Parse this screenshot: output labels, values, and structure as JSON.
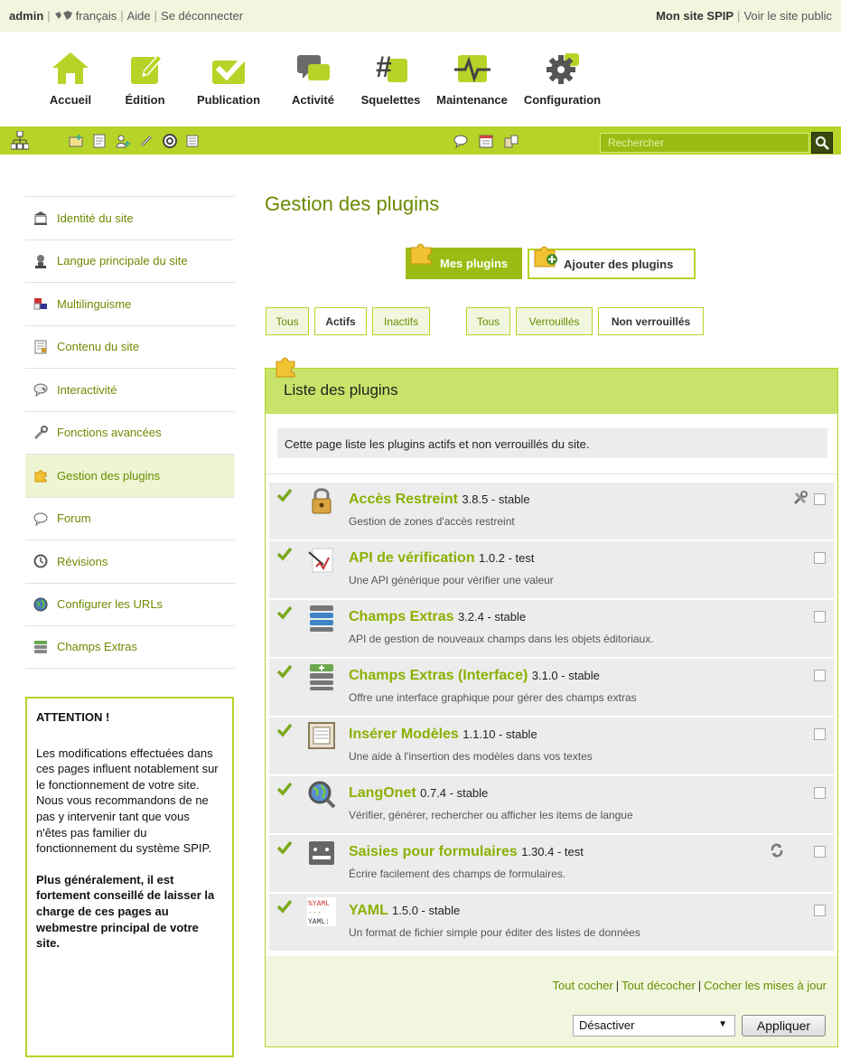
{
  "topbar": {
    "user": "admin",
    "language": "français",
    "help": "Aide",
    "logout": "Se déconnecter",
    "site_name": "Mon site SPIP",
    "view_site": "Voir le site public"
  },
  "mainnav": [
    {
      "label": "Accueil",
      "icon": "home-icon"
    },
    {
      "label": "Édition",
      "icon": "pencil-icon"
    },
    {
      "label": "Publication",
      "icon": "checkmark-icon"
    },
    {
      "label": "Activité",
      "icon": "chat-bubbles-icon"
    },
    {
      "label": "Squelettes",
      "icon": "hash-icon"
    },
    {
      "label": "Maintenance",
      "icon": "heartbeat-icon"
    },
    {
      "label": "Configuration",
      "icon": "gear-icon"
    }
  ],
  "search": {
    "placeholder": "Rechercher"
  },
  "sidebar": {
    "items": [
      {
        "label": "Identité du site",
        "icon": "building-icon"
      },
      {
        "label": "Langue principale du site",
        "icon": "language-speaker-icon"
      },
      {
        "label": "Multilinguisme",
        "icon": "flags-icon"
      },
      {
        "label": "Contenu du site",
        "icon": "content-page-icon"
      },
      {
        "label": "Interactivité",
        "icon": "interactivity-bubble-icon"
      },
      {
        "label": "Fonctions avancées",
        "icon": "wrench-icon"
      },
      {
        "label": "Gestion des plugins",
        "icon": "puzzle-icon"
      },
      {
        "label": "Forum",
        "icon": "speech-bubble-icon"
      },
      {
        "label": "Révisions",
        "icon": "history-icon"
      },
      {
        "label": "Configurer les URLs",
        "icon": "url-globe-icon"
      },
      {
        "label": "Champs Extras",
        "icon": "fields-stack-icon"
      }
    ],
    "active_index": 6
  },
  "attention": {
    "title": "ATTENTION !",
    "body": "Les modifications effectuées dans ces pages influent notablement sur le fonctionnement de votre site. Nous vous recommandons de ne pas y intervenir tant que vous n'êtes pas familier du fonctionnement du système SPIP.",
    "strong": "Plus généralement, il est fortement conseillé de laisser la charge de ces pages au webmestre principal de votre site."
  },
  "page": {
    "title": "Gestion des plugins",
    "tab_mine": "Mes plugins",
    "tab_add": "Ajouter des plugins",
    "filters_state": [
      "Tous",
      "Actifs",
      "Inactifs"
    ],
    "filters_lock": [
      "Tous",
      "Verrouillés",
      "Non verrouillés"
    ],
    "box_title": "Liste des plugins",
    "box_intro": "Cette page liste les plugins actifs et non verrouillés du site."
  },
  "plugins": [
    {
      "name": "Accès Restreint",
      "version": "3.8.5 - stable",
      "desc": "Gestion de zones d'accès restreint",
      "icon": "padlock-icon",
      "extra": "tools-icon"
    },
    {
      "name": "API de vérification",
      "version": "1.0.2 - test",
      "desc": "Une API générique pour vérifier une valeur",
      "icon": "verification-icon"
    },
    {
      "name": "Champs Extras",
      "version": "3.2.4 - stable",
      "desc": "API de gestion de nouveaux champs dans les objets éditoriaux.",
      "icon": "fields-stack-icon"
    },
    {
      "name": "Champs Extras (Interface)",
      "version": "3.1.0 - stable",
      "desc": "Offre une interface graphique pour gérer des champs extras",
      "icon": "fields-add-icon"
    },
    {
      "name": "Insérer Modèles",
      "version": "1.1.10 - stable",
      "desc": "Une aide à l'insertion des modèles dans vos textes",
      "icon": "template-icon"
    },
    {
      "name": "LangOnet",
      "version": "0.7.4 - stable",
      "desc": "Vérifier, générer, rechercher ou afficher les items de langue",
      "icon": "magnifier-globe-icon"
    },
    {
      "name": "Saisies pour formulaires",
      "version": "1.30.4 - test",
      "desc": "Écrire facilement des champs de formulaires.",
      "icon": "form-input-icon",
      "extra": "refresh-icon"
    },
    {
      "name": "YAML",
      "version": "1.5.0 - stable",
      "desc": "Un format de fichier simple pour éditer des listes de données",
      "icon": "yaml-icon"
    }
  ],
  "footer": {
    "check_all": "Tout cocher",
    "uncheck_all": "Tout décocher",
    "check_updates": "Cocher les mises à jour",
    "action_value": "Désactiver",
    "apply": "Appliquer"
  },
  "colors": {
    "accent": "#b5d427",
    "accent_dark": "#9cbc13",
    "link": "#6c8a00",
    "plugin_name": "#8bb000"
  }
}
